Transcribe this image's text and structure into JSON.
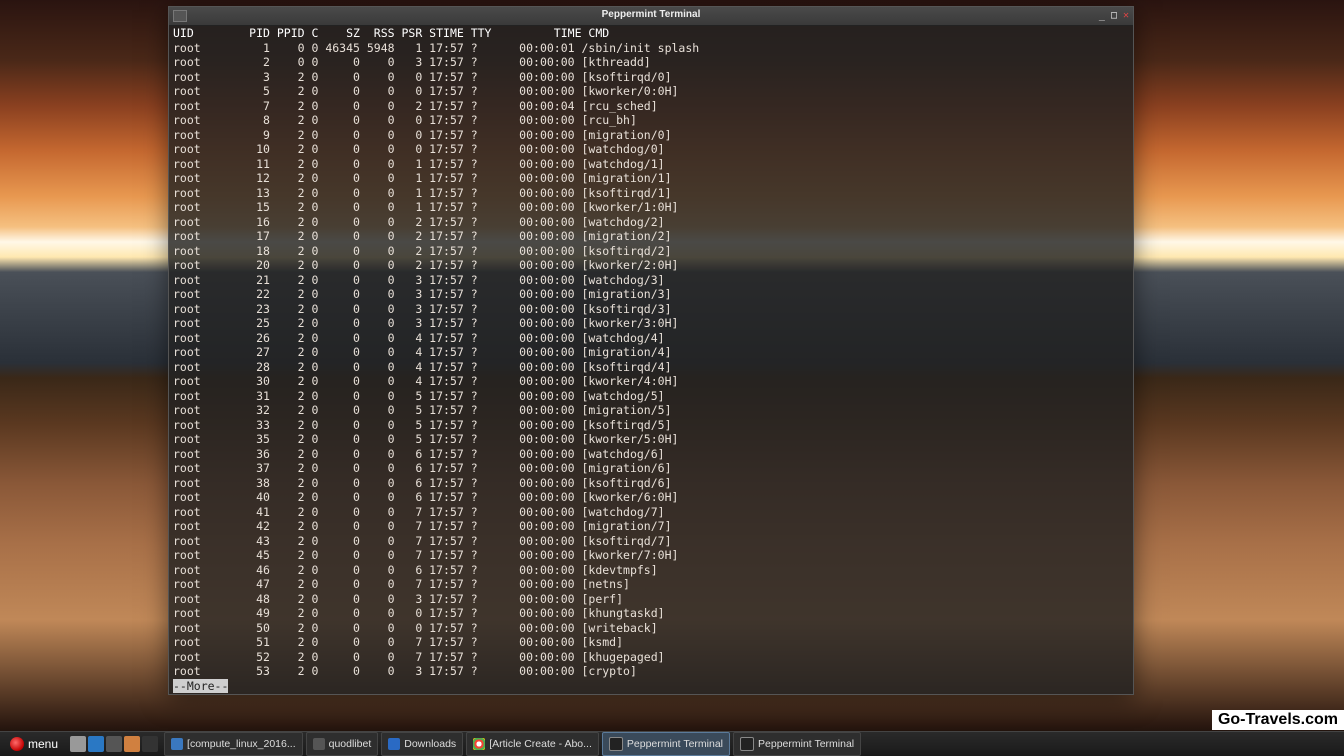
{
  "window": {
    "title": "Peppermint Terminal"
  },
  "header": [
    "UID",
    "PID",
    "PPID",
    "C",
    "SZ",
    "RSS",
    "PSR",
    "STIME",
    "TTY",
    "TIME",
    "CMD"
  ],
  "rows": [
    [
      "root",
      "1",
      "0",
      "0",
      "46345",
      "5948",
      "1",
      "17:57",
      "?",
      "00:00:01",
      "/sbin/init splash"
    ],
    [
      "root",
      "2",
      "0",
      "0",
      "0",
      "0",
      "3",
      "17:57",
      "?",
      "00:00:00",
      "[kthreadd]"
    ],
    [
      "root",
      "3",
      "2",
      "0",
      "0",
      "0",
      "0",
      "17:57",
      "?",
      "00:00:00",
      "[ksoftirqd/0]"
    ],
    [
      "root",
      "5",
      "2",
      "0",
      "0",
      "0",
      "0",
      "17:57",
      "?",
      "00:00:00",
      "[kworker/0:0H]"
    ],
    [
      "root",
      "7",
      "2",
      "0",
      "0",
      "0",
      "2",
      "17:57",
      "?",
      "00:00:04",
      "[rcu_sched]"
    ],
    [
      "root",
      "8",
      "2",
      "0",
      "0",
      "0",
      "0",
      "17:57",
      "?",
      "00:00:00",
      "[rcu_bh]"
    ],
    [
      "root",
      "9",
      "2",
      "0",
      "0",
      "0",
      "0",
      "17:57",
      "?",
      "00:00:00",
      "[migration/0]"
    ],
    [
      "root",
      "10",
      "2",
      "0",
      "0",
      "0",
      "0",
      "17:57",
      "?",
      "00:00:00",
      "[watchdog/0]"
    ],
    [
      "root",
      "11",
      "2",
      "0",
      "0",
      "0",
      "1",
      "17:57",
      "?",
      "00:00:00",
      "[watchdog/1]"
    ],
    [
      "root",
      "12",
      "2",
      "0",
      "0",
      "0",
      "1",
      "17:57",
      "?",
      "00:00:00",
      "[migration/1]"
    ],
    [
      "root",
      "13",
      "2",
      "0",
      "0",
      "0",
      "1",
      "17:57",
      "?",
      "00:00:00",
      "[ksoftirqd/1]"
    ],
    [
      "root",
      "15",
      "2",
      "0",
      "0",
      "0",
      "1",
      "17:57",
      "?",
      "00:00:00",
      "[kworker/1:0H]"
    ],
    [
      "root",
      "16",
      "2",
      "0",
      "0",
      "0",
      "2",
      "17:57",
      "?",
      "00:00:00",
      "[watchdog/2]"
    ],
    [
      "root",
      "17",
      "2",
      "0",
      "0",
      "0",
      "2",
      "17:57",
      "?",
      "00:00:00",
      "[migration/2]"
    ],
    [
      "root",
      "18",
      "2",
      "0",
      "0",
      "0",
      "2",
      "17:57",
      "?",
      "00:00:00",
      "[ksoftirqd/2]"
    ],
    [
      "root",
      "20",
      "2",
      "0",
      "0",
      "0",
      "2",
      "17:57",
      "?",
      "00:00:00",
      "[kworker/2:0H]"
    ],
    [
      "root",
      "21",
      "2",
      "0",
      "0",
      "0",
      "3",
      "17:57",
      "?",
      "00:00:00",
      "[watchdog/3]"
    ],
    [
      "root",
      "22",
      "2",
      "0",
      "0",
      "0",
      "3",
      "17:57",
      "?",
      "00:00:00",
      "[migration/3]"
    ],
    [
      "root",
      "23",
      "2",
      "0",
      "0",
      "0",
      "3",
      "17:57",
      "?",
      "00:00:00",
      "[ksoftirqd/3]"
    ],
    [
      "root",
      "25",
      "2",
      "0",
      "0",
      "0",
      "3",
      "17:57",
      "?",
      "00:00:00",
      "[kworker/3:0H]"
    ],
    [
      "root",
      "26",
      "2",
      "0",
      "0",
      "0",
      "4",
      "17:57",
      "?",
      "00:00:00",
      "[watchdog/4]"
    ],
    [
      "root",
      "27",
      "2",
      "0",
      "0",
      "0",
      "4",
      "17:57",
      "?",
      "00:00:00",
      "[migration/4]"
    ],
    [
      "root",
      "28",
      "2",
      "0",
      "0",
      "0",
      "4",
      "17:57",
      "?",
      "00:00:00",
      "[ksoftirqd/4]"
    ],
    [
      "root",
      "30",
      "2",
      "0",
      "0",
      "0",
      "4",
      "17:57",
      "?",
      "00:00:00",
      "[kworker/4:0H]"
    ],
    [
      "root",
      "31",
      "2",
      "0",
      "0",
      "0",
      "5",
      "17:57",
      "?",
      "00:00:00",
      "[watchdog/5]"
    ],
    [
      "root",
      "32",
      "2",
      "0",
      "0",
      "0",
      "5",
      "17:57",
      "?",
      "00:00:00",
      "[migration/5]"
    ],
    [
      "root",
      "33",
      "2",
      "0",
      "0",
      "0",
      "5",
      "17:57",
      "?",
      "00:00:00",
      "[ksoftirqd/5]"
    ],
    [
      "root",
      "35",
      "2",
      "0",
      "0",
      "0",
      "5",
      "17:57",
      "?",
      "00:00:00",
      "[kworker/5:0H]"
    ],
    [
      "root",
      "36",
      "2",
      "0",
      "0",
      "0",
      "6",
      "17:57",
      "?",
      "00:00:00",
      "[watchdog/6]"
    ],
    [
      "root",
      "37",
      "2",
      "0",
      "0",
      "0",
      "6",
      "17:57",
      "?",
      "00:00:00",
      "[migration/6]"
    ],
    [
      "root",
      "38",
      "2",
      "0",
      "0",
      "0",
      "6",
      "17:57",
      "?",
      "00:00:00",
      "[ksoftirqd/6]"
    ],
    [
      "root",
      "40",
      "2",
      "0",
      "0",
      "0",
      "6",
      "17:57",
      "?",
      "00:00:00",
      "[kworker/6:0H]"
    ],
    [
      "root",
      "41",
      "2",
      "0",
      "0",
      "0",
      "7",
      "17:57",
      "?",
      "00:00:00",
      "[watchdog/7]"
    ],
    [
      "root",
      "42",
      "2",
      "0",
      "0",
      "0",
      "7",
      "17:57",
      "?",
      "00:00:00",
      "[migration/7]"
    ],
    [
      "root",
      "43",
      "2",
      "0",
      "0",
      "0",
      "7",
      "17:57",
      "?",
      "00:00:00",
      "[ksoftirqd/7]"
    ],
    [
      "root",
      "45",
      "2",
      "0",
      "0",
      "0",
      "7",
      "17:57",
      "?",
      "00:00:00",
      "[kworker/7:0H]"
    ],
    [
      "root",
      "46",
      "2",
      "0",
      "0",
      "0",
      "6",
      "17:57",
      "?",
      "00:00:00",
      "[kdevtmpfs]"
    ],
    [
      "root",
      "47",
      "2",
      "0",
      "0",
      "0",
      "7",
      "17:57",
      "?",
      "00:00:00",
      "[netns]"
    ],
    [
      "root",
      "48",
      "2",
      "0",
      "0",
      "0",
      "3",
      "17:57",
      "?",
      "00:00:00",
      "[perf]"
    ],
    [
      "root",
      "49",
      "2",
      "0",
      "0",
      "0",
      "0",
      "17:57",
      "?",
      "00:00:00",
      "[khungtaskd]"
    ],
    [
      "root",
      "50",
      "2",
      "0",
      "0",
      "0",
      "0",
      "17:57",
      "?",
      "00:00:00",
      "[writeback]"
    ],
    [
      "root",
      "51",
      "2",
      "0",
      "0",
      "0",
      "7",
      "17:57",
      "?",
      "00:00:00",
      "[ksmd]"
    ],
    [
      "root",
      "52",
      "2",
      "0",
      "0",
      "0",
      "7",
      "17:57",
      "?",
      "00:00:00",
      "[khugepaged]"
    ],
    [
      "root",
      "53",
      "2",
      "0",
      "0",
      "0",
      "3",
      "17:57",
      "?",
      "00:00:00",
      "[crypto]"
    ]
  ],
  "pager": "--More--",
  "taskbar": {
    "menu": "menu",
    "items": [
      {
        "icon": "file",
        "label": "[compute_linux_2016..."
      },
      {
        "icon": "music",
        "label": "quodlibet"
      },
      {
        "icon": "dl",
        "label": "Downloads"
      },
      {
        "icon": "chr",
        "label": "[Article Create - Abo..."
      },
      {
        "icon": "term",
        "label": "Peppermint Terminal",
        "active": true
      },
      {
        "icon": "term",
        "label": "Peppermint Terminal"
      }
    ]
  },
  "watermark": "Go-Travels.com"
}
